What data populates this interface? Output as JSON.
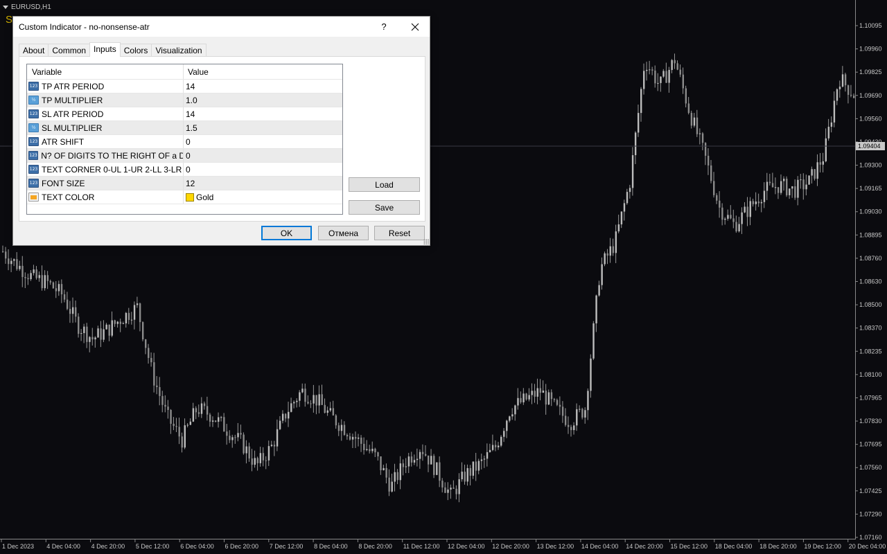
{
  "chart": {
    "symbol": "EURUSD,H1",
    "corner_text": "S",
    "current_price": "1.09404",
    "price_labels": [
      "1.10095",
      "1.09960",
      "1.09825",
      "1.09690",
      "1.09560",
      "1.09430",
      "1.09300",
      "1.09165",
      "1.09030",
      "1.08895",
      "1.08760",
      "1.08630",
      "1.08500",
      "1.08370",
      "1.08235",
      "1.08100",
      "1.07965",
      "1.07830",
      "1.07695",
      "1.07560",
      "1.07425",
      "1.07290",
      "1.07160"
    ],
    "time_labels": [
      "1 Dec 2023",
      "4 Dec 04:00",
      "4 Dec 20:00",
      "5 Dec 12:00",
      "6 Dec 04:00",
      "6 Dec 20:00",
      "7 Dec 12:00",
      "8 Dec 04:00",
      "8 Dec 20:00",
      "11 Dec 12:00",
      "12 Dec 04:00",
      "12 Dec 20:00",
      "13 Dec 12:00",
      "14 Dec 04:00",
      "14 Dec 20:00",
      "15 Dec 12:00",
      "18 Dec 04:00",
      "18 Dec 20:00",
      "19 Dec 12:00",
      "20 Dec 04:00"
    ],
    "price_trend": [
      1.088,
      1.0872,
      1.0865,
      1.0862,
      1.0855,
      1.0838,
      1.083,
      1.0835,
      1.0842,
      1.0848,
      1.081,
      1.0785,
      1.0772,
      1.079,
      1.0786,
      1.0778,
      1.077,
      1.0757,
      1.0768,
      1.0788,
      1.08,
      1.0795,
      1.0785,
      1.0778,
      1.077,
      1.0762,
      1.0745,
      1.076,
      1.0768,
      1.0755,
      1.074,
      1.0752,
      1.0758,
      1.0768,
      1.079,
      1.0795,
      1.08,
      1.079,
      1.0782,
      1.079,
      1.087,
      1.0885,
      1.092,
      1.099,
      1.0975,
      1.099,
      1.096,
      1.0935,
      1.0905,
      1.0895,
      1.0905,
      1.0915,
      1.0918,
      1.0915,
      1.092,
      1.0935,
      1.098,
      1.097
    ]
  },
  "dialog": {
    "title": "Custom Indicator - no-nonsense-atr",
    "help_label": "?",
    "tabs": [
      {
        "label": "About"
      },
      {
        "label": "Common"
      },
      {
        "label": "Inputs"
      },
      {
        "label": "Colors"
      },
      {
        "label": "Visualization"
      }
    ],
    "active_tab": "Inputs",
    "grid": {
      "header_variable": "Variable",
      "header_value": "Value",
      "rows": [
        {
          "type": "int",
          "icon_text": "123",
          "variable": "TP ATR PERIOD",
          "value": "14"
        },
        {
          "type": "double",
          "icon_text": "½",
          "variable": "TP MULTIPLIER",
          "value": "1.0"
        },
        {
          "type": "int",
          "icon_text": "123",
          "variable": "SL ATR PERIOD",
          "value": "14"
        },
        {
          "type": "double",
          "icon_text": "½",
          "variable": "SL MULTIPLIER",
          "value": "1.5"
        },
        {
          "type": "int",
          "icon_text": "123",
          "variable": "ATR SHIFT",
          "value": "0"
        },
        {
          "type": "int",
          "icon_text": "123",
          "variable": "N? OF DIGITS TO THE RIGHT OF a D...",
          "value": "0"
        },
        {
          "type": "int",
          "icon_text": "123",
          "variable": "TEXT CORNER 0-UL 1-UR 2-LL 3-LR",
          "value": "0"
        },
        {
          "type": "int",
          "icon_text": "123",
          "variable": "FONT SIZE",
          "value": "12"
        },
        {
          "type": "color",
          "icon_text": "",
          "variable": "TEXT COLOR",
          "value": "Gold",
          "swatch": "#FFD700"
        }
      ]
    },
    "buttons": {
      "load": "Load",
      "save": "Save",
      "ok": "OK",
      "cancel": "Отмена",
      "reset": "Reset"
    }
  }
}
